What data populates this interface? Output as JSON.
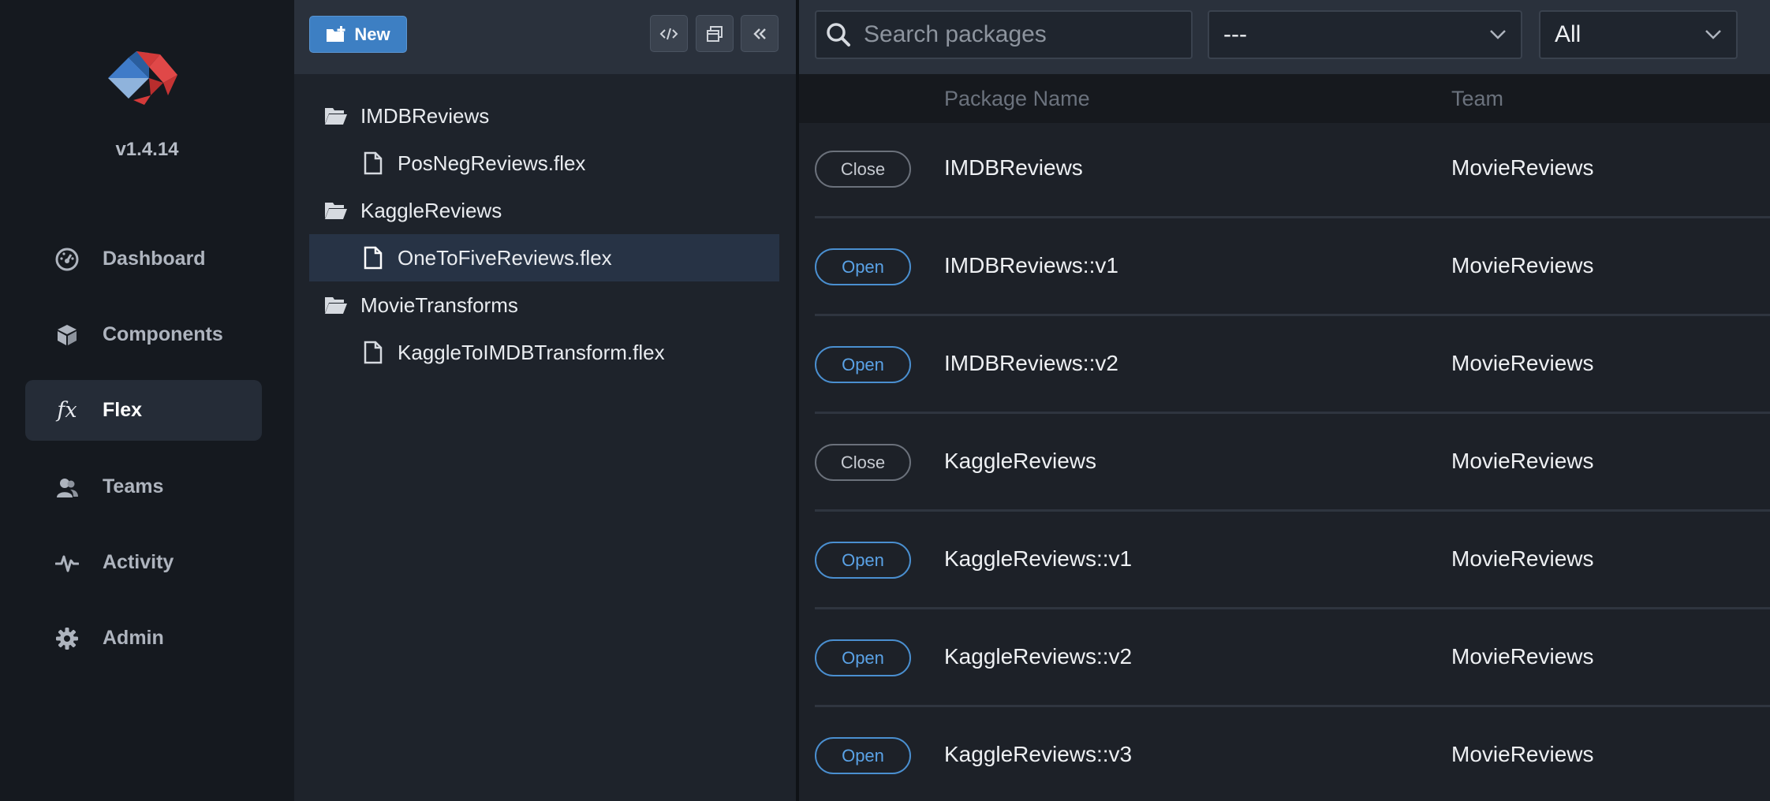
{
  "app": {
    "version": "v1.4.14",
    "brand_colors": {
      "blue": "#4a7fbf",
      "red": "#d33a3a",
      "accent": "#3d7fc3"
    }
  },
  "nav": {
    "items": [
      {
        "label": "Dashboard",
        "icon": "gauge-icon",
        "active": false
      },
      {
        "label": "Components",
        "icon": "cube-icon",
        "active": false
      },
      {
        "label": "Flex",
        "icon": "fx-icon",
        "active": true
      },
      {
        "label": "Teams",
        "icon": "users-icon",
        "active": false
      },
      {
        "label": "Activity",
        "icon": "pulse-icon",
        "active": false
      },
      {
        "label": "Admin",
        "icon": "gear-icon",
        "active": false
      }
    ],
    "fx_glyph": "fx"
  },
  "tree": {
    "new_label": "New",
    "toolbar_icons": [
      "code-icon",
      "copy-icon",
      "collapse-icon"
    ],
    "items": [
      {
        "type": "folder",
        "label": "IMDBReviews"
      },
      {
        "type": "file",
        "label": "PosNegReviews.flex"
      },
      {
        "type": "folder",
        "label": "KaggleReviews"
      },
      {
        "type": "file",
        "label": "OneToFiveReviews.flex",
        "selected": true
      },
      {
        "type": "folder",
        "label": "MovieTransforms"
      },
      {
        "type": "file",
        "label": "KaggleToIMDBTransform.flex"
      }
    ]
  },
  "packages": {
    "search_placeholder": "Search packages",
    "filter1_value": "---",
    "filter2_value": "All",
    "columns": {
      "name": "Package Name",
      "team": "Team"
    },
    "rows": [
      {
        "action": "Close",
        "name": "IMDBReviews",
        "team": "MovieReviews"
      },
      {
        "action": "Open",
        "name": "IMDBReviews::v1",
        "team": "MovieReviews"
      },
      {
        "action": "Open",
        "name": "IMDBReviews::v2",
        "team": "MovieReviews"
      },
      {
        "action": "Close",
        "name": "KaggleReviews",
        "team": "MovieReviews"
      },
      {
        "action": "Open",
        "name": "KaggleReviews::v1",
        "team": "MovieReviews"
      },
      {
        "action": "Open",
        "name": "KaggleReviews::v2",
        "team": "MovieReviews"
      },
      {
        "action": "Open",
        "name": "KaggleReviews::v3",
        "team": "MovieReviews"
      }
    ]
  }
}
